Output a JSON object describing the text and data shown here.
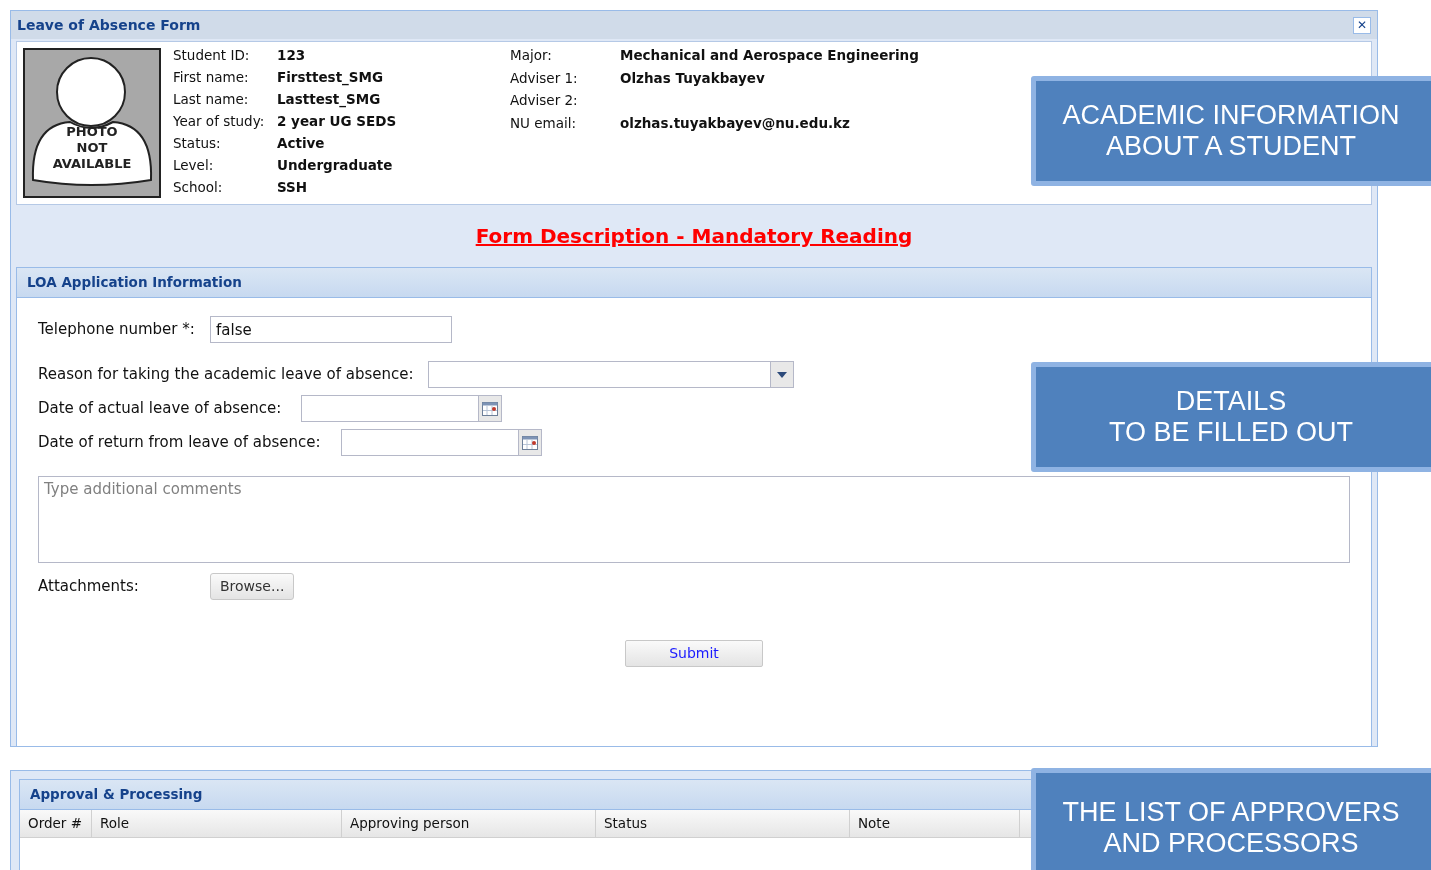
{
  "window": {
    "title": "Leave of Absence Form",
    "close": "✕"
  },
  "photo": {
    "lines": [
      "PHOTO",
      "NOT",
      "AVAILABLE"
    ]
  },
  "student_left": [
    {
      "label": "Student ID:",
      "value": "123"
    },
    {
      "label": "First name:",
      "value": "Firsttest_SMG"
    },
    {
      "label": "Last name:",
      "value": "Lasttest_SMG"
    },
    {
      "label": "Year of study:",
      "value": "2 year UG SEDS"
    },
    {
      "label": "Status:",
      "value": "Active"
    },
    {
      "label": "Level:",
      "value": "Undergraduate"
    },
    {
      "label": "School:",
      "value": "SSH"
    }
  ],
  "student_right": [
    {
      "label": "Major:",
      "value": "Mechanical and Aerospace Engineering"
    },
    {
      "label": "Adviser 1:",
      "value": "Olzhas Tuyakbayev"
    },
    {
      "label": "Adviser 2:"
    },
    {
      "label": "NU email:",
      "value": "olzhas.tuyakbayev@nu.edu.kz"
    }
  ],
  "form_description_link": "Form Description - Mandatory Reading",
  "loa_section": {
    "title": "LOA Application Information",
    "fields": [
      {
        "kind": "text",
        "label": "Telephone number *:",
        "value": "false"
      },
      {
        "kind": "select",
        "label": "Reason for taking the academic leave of absence:"
      },
      {
        "kind": "date",
        "label": "Date of actual leave of absence:"
      },
      {
        "kind": "date",
        "label": "Date of return from leave of absence:"
      },
      {
        "kind": "textarea",
        "placeholder": "Type additional comments"
      },
      {
        "kind": "file",
        "label": "Attachments:",
        "button": "Browse..."
      }
    ],
    "submit": "Submit"
  },
  "approval": {
    "title": "Approval & Processing",
    "columns": [
      "Order #",
      "Role",
      "Approving person",
      "Status",
      "Note"
    ]
  },
  "callouts": [
    {
      "lines": [
        "ACADEMIC INFORMATION",
        "ABOUT A STUDENT"
      ]
    },
    {
      "lines": [
        "DETAILS",
        "TO BE FILLED OUT"
      ]
    },
    {
      "lines": [
        "THE LIST OF APPROVERS",
        "AND PROCESSORS"
      ]
    }
  ]
}
